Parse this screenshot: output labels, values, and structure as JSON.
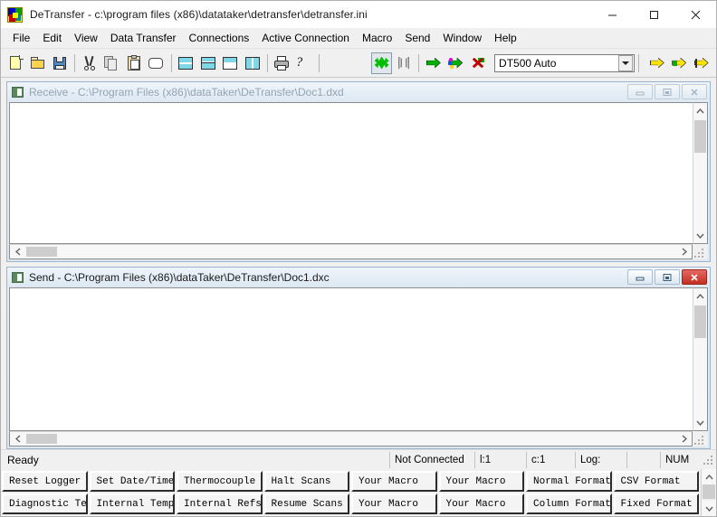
{
  "window": {
    "title": "DeTransfer - c:\\program files (x86)\\datataker\\detransfer\\detransfer.ini",
    "minimize_label": "Minimize",
    "maximize_label": "Maximize",
    "close_label": "Close"
  },
  "menu": {
    "items": [
      {
        "label": "File"
      },
      {
        "label": "Edit"
      },
      {
        "label": "View"
      },
      {
        "label": "Data Transfer"
      },
      {
        "label": "Connections"
      },
      {
        "label": "Active Connection"
      },
      {
        "label": "Macro"
      },
      {
        "label": "Send"
      },
      {
        "label": "Window"
      },
      {
        "label": "Help"
      }
    ]
  },
  "toolbar": {
    "buttons": [
      {
        "name": "new-document-button",
        "tip": "New"
      },
      {
        "name": "open-document-button",
        "tip": "Open"
      },
      {
        "name": "save-document-button",
        "tip": "Save"
      },
      {
        "name": "cut-button",
        "tip": "Cut"
      },
      {
        "name": "copy-button",
        "tip": "Copy"
      },
      {
        "name": "paste-button",
        "tip": "Paste"
      },
      {
        "name": "clear-button",
        "tip": "Clear"
      },
      {
        "name": "tile-horizontal-button",
        "tip": "Tile Horizontally"
      },
      {
        "name": "tile-split-button",
        "tip": "Split"
      },
      {
        "name": "tile-stack-button",
        "tip": "Stack"
      },
      {
        "name": "tile-vertical-button",
        "tip": "Tile Vertically"
      },
      {
        "name": "print-button",
        "tip": "Print"
      },
      {
        "name": "help-button",
        "tip": "Help"
      },
      {
        "name": "connect-button",
        "tip": "Connect"
      },
      {
        "name": "disconnect-button",
        "tip": "Disconnect"
      },
      {
        "name": "send-file-button",
        "tip": "Send File"
      },
      {
        "name": "send-data-button",
        "tip": "Send Data"
      },
      {
        "name": "cancel-send-button",
        "tip": "Cancel Send"
      },
      {
        "name": "send-all-button",
        "tip": "Send All"
      },
      {
        "name": "send-selection-button",
        "tip": "Send Selection"
      },
      {
        "name": "send-line-button",
        "tip": "Send Line"
      }
    ],
    "connection_combo": {
      "value": "DT500 Auto",
      "options": [
        "DT500 Auto"
      ]
    }
  },
  "receive_window": {
    "title": "Receive - C:\\Program Files (x86)\\dataTaker\\DeTransfer\\Doc1.dxd",
    "content": "",
    "active": false
  },
  "send_window": {
    "title": "Send - C:\\Program Files (x86)\\dataTaker\\DeTransfer\\Doc1.dxc",
    "content": "",
    "active": true
  },
  "statusbar": {
    "message": "Ready",
    "connection": "Not Connected",
    "line": "l:1",
    "column": "c:1",
    "log": "Log:",
    "blank": "",
    "num_lock": "NUM"
  },
  "macros": {
    "row1": [
      {
        "label": "Reset Logger"
      },
      {
        "label": "Set Date/Time"
      },
      {
        "label": "Thermocouple"
      },
      {
        "label": "Halt Scans"
      },
      {
        "label": "Your Macro"
      },
      {
        "label": "Your Macro"
      },
      {
        "label": "Normal Format"
      },
      {
        "label": "CSV Format"
      }
    ],
    "row2": [
      {
        "label": "Diagnostic Test"
      },
      {
        "label": "Internal Temp"
      },
      {
        "label": "Internal Refs"
      },
      {
        "label": "Resume Scans"
      },
      {
        "label": "Your Macro"
      },
      {
        "label": "Your Macro"
      },
      {
        "label": "Column Format"
      },
      {
        "label": "Fixed Format"
      }
    ]
  },
  "colors": {
    "accent_blue": "#9bb4cc",
    "close_red": "#c12f22",
    "green_arrow": "#00b000",
    "yellow_arrow": "#ffe400",
    "window_bg": "#f0f0f0"
  }
}
